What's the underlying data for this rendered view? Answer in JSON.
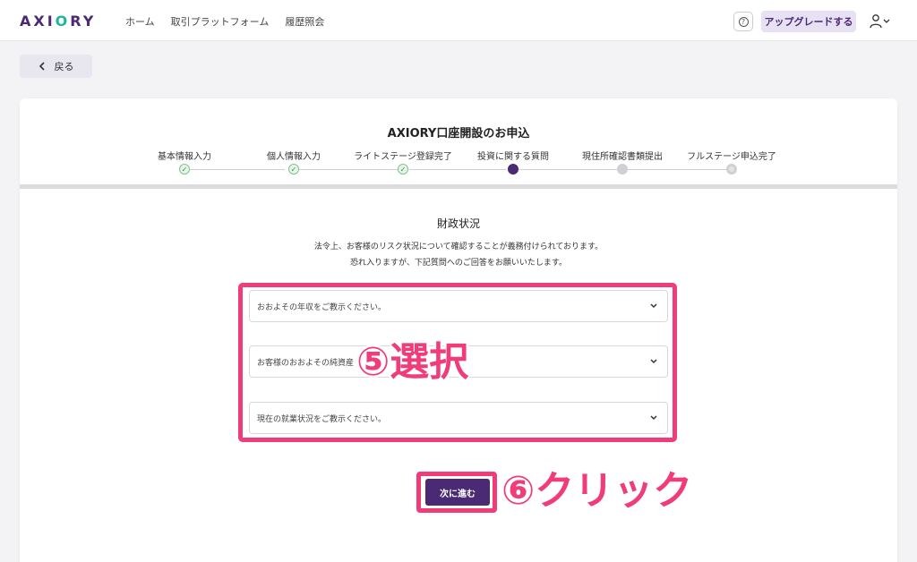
{
  "header": {
    "logo_prefix": "AXI",
    "logo_o": "O",
    "logo_suffix": "RY",
    "nav": [
      "ホーム",
      "取引プラットフォーム",
      "履歴照会"
    ],
    "help_label": "?",
    "upgrade_label": "アップグレードする"
  },
  "back_label": "戻る",
  "form": {
    "title": "AXIORY口座開設のお申込",
    "steps": [
      {
        "label": "基本情報入力",
        "status": "done"
      },
      {
        "label": "個人情報入力",
        "status": "done"
      },
      {
        "label": "ライトステージ登録完了",
        "status": "done"
      },
      {
        "label": "投資に関する質問",
        "status": "current"
      },
      {
        "label": "現住所確認書類提出",
        "status": "todo"
      },
      {
        "label": "フルステージ申込完了",
        "status": "todo"
      }
    ],
    "section_title": "財政状況",
    "description_line1": "法令上、お客様のリスク状況について確認することが義務付けられております。",
    "description_line2": "恐れ入りますが、下記質問へのご回答をお願いいたします。",
    "selects": [
      {
        "placeholder": "おおよその年収をご教示ください。"
      },
      {
        "placeholder": "お客様のおおよその純資産"
      },
      {
        "placeholder": "現在の就業状況をご教示ください。"
      }
    ],
    "next_label": "次に進む"
  },
  "annotations": {
    "select_step": "⑤選択",
    "click_step": "⑥クリック"
  },
  "colors": {
    "brand": "#4a2a74",
    "accent_teal": "#1db5a0",
    "highlight": "#f03c78",
    "done_green": "#2f8f45"
  }
}
